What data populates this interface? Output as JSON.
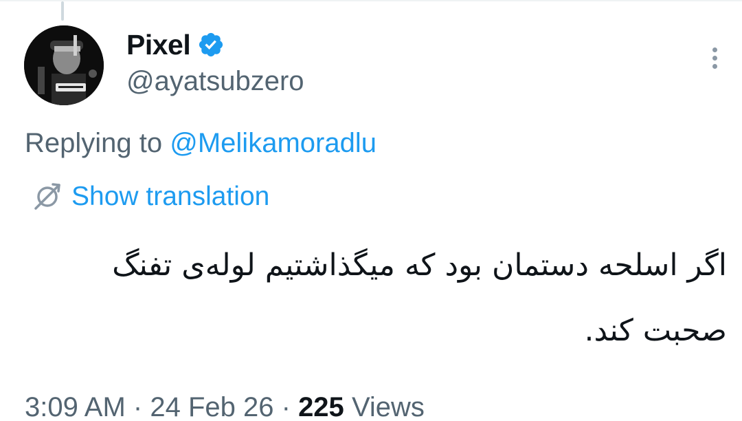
{
  "author": {
    "display_name": "Pixel",
    "handle": "@ayatsubzero",
    "verified": true
  },
  "reply": {
    "prefix": "Replying to",
    "mention": "@Melikamoradlu"
  },
  "translation": {
    "label": "Show translation",
    "icon": "globe-icon"
  },
  "tweet": {
    "text": "اگر اسلحه دستمان بود که میگذاشتیم لوله‌ی تفنگ صحبت کند."
  },
  "meta": {
    "time": "3:09 AM",
    "separator": "·",
    "date": "24 Feb 26",
    "views_count": "225",
    "views_label": "Views"
  },
  "icons": {
    "verified": "verified-badge-icon",
    "more": "more-vertical-icon"
  },
  "colors": {
    "accent": "#1d9bf0",
    "secondary_text": "#536471",
    "primary_text": "#0f1419"
  }
}
